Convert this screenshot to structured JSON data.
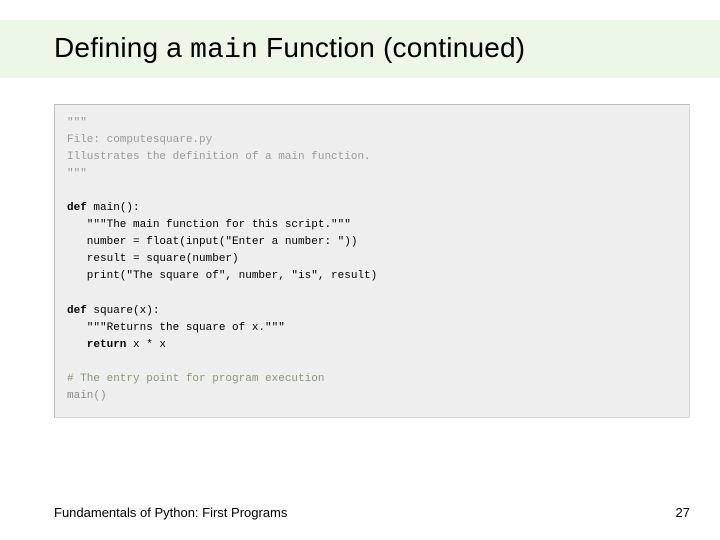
{
  "title": {
    "pre": "Defining a ",
    "mono": "main",
    "post": " Function (continued)"
  },
  "code": {
    "l1": "\"\"\"",
    "l2": "File: computesquare.py",
    "l3": "Illustrates the definition of a main function.",
    "l4": "\"\"\"",
    "blank1": "",
    "def_main": "def",
    "def_main_rest": " main():",
    "main_doc": "   \"\"\"The main function for this script.\"\"\"",
    "main_l1": "   number = float(input(\"Enter a number: \"))",
    "main_l2": "   result = square(number)",
    "main_l3": "   print(\"The square of\", number, \"is\", result)",
    "blank2": "",
    "def_sq": "def",
    "def_sq_rest": " square(x):",
    "sq_doc": "   \"\"\"Returns the square of x.\"\"\"",
    "ret_kw": "   return",
    "ret_rest": " x * x",
    "blank3": "",
    "comment": "# The entry point for program execution",
    "call": "main()"
  },
  "footer": "Fundamentals of Python: First Programs",
  "page": "27"
}
